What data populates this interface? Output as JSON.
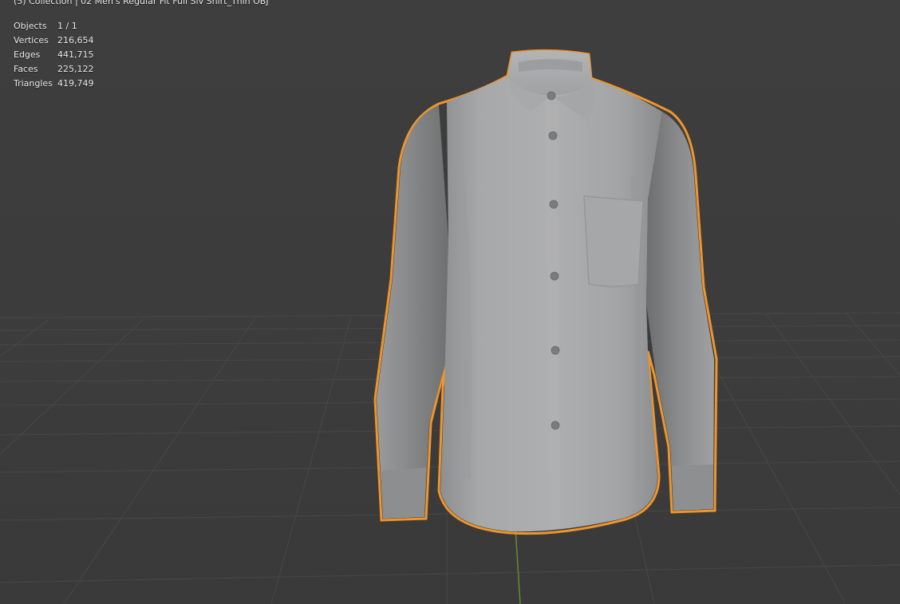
{
  "viewport": {
    "collection_label": "(5) Collection | 02 Men's Regular Fit Full Slv Shirt_Thin OBJ",
    "background_color": "#3d3d3d",
    "selection_outline_color": "#f0952a",
    "object_color": "#a9aaab",
    "stats": [
      {
        "label": "Objects",
        "value": "1 / 1"
      },
      {
        "label": "Vertices",
        "value": "216,654"
      },
      {
        "label": "Edges",
        "value": "441,715"
      },
      {
        "label": "Faces",
        "value": "225,122"
      },
      {
        "label": "Triangles",
        "value": "419,749"
      }
    ],
    "selected_object": "shirt-mesh"
  }
}
